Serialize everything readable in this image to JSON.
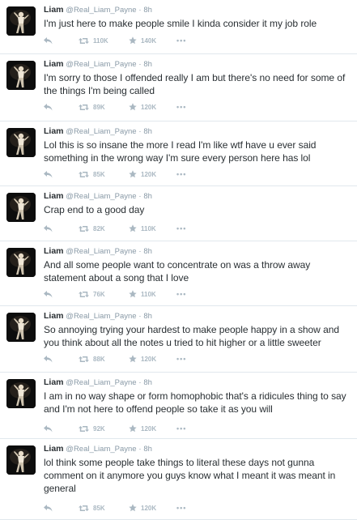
{
  "tweets": [
    {
      "name": "Liam",
      "handle": "@Real_Liam_Payne",
      "dot": "·",
      "time": "8h",
      "text": "I'm just here to make people smile  I kinda consider it my job role",
      "retweets": "110K",
      "favorites": "140K"
    },
    {
      "name": "Liam",
      "handle": "@Real_Liam_Payne",
      "dot": "·",
      "time": "8h",
      "text": "I'm sorry to those I offended really I am but there's no need for some of the things I'm being called",
      "retweets": "89K",
      "favorites": "120K"
    },
    {
      "name": "Liam",
      "handle": "@Real_Liam_Payne",
      "dot": "·",
      "time": "8h",
      "text": "Lol this is so insane the more I read I'm like wtf have u ever said something in the wrong way I'm sure every person here has lol",
      "retweets": "85K",
      "favorites": "120K"
    },
    {
      "name": "Liam",
      "handle": "@Real_Liam_Payne",
      "dot": "·",
      "time": "8h",
      "text": "Crap end to a good day",
      "retweets": "82K",
      "favorites": "110K"
    },
    {
      "name": "Liam",
      "handle": "@Real_Liam_Payne",
      "dot": "·",
      "time": "8h",
      "text": "And all some people want to concentrate on was a throw away statement about a song that I love",
      "retweets": "76K",
      "favorites": "110K"
    },
    {
      "name": "Liam",
      "handle": "@Real_Liam_Payne",
      "dot": "·",
      "time": "8h",
      "text": "So annoying trying your hardest to make people happy in a show and you think about all the notes u tried to hit higher or a little sweeter",
      "retweets": "88K",
      "favorites": "120K"
    },
    {
      "name": "Liam",
      "handle": "@Real_Liam_Payne",
      "dot": "·",
      "time": "8h",
      "text": "I am in no way shape or form homophobic that's a ridicules thing to say and I'm not here to offend people so take it as you will",
      "retweets": "92K",
      "favorites": "120K"
    },
    {
      "name": "Liam",
      "handle": "@Real_Liam_Payne",
      "dot": "·",
      "time": "8h",
      "text": "lol think some people take things to literal these days not gunna comment on it anymore you guys know what I meant it was meant in general",
      "retweets": "85K",
      "favorites": "120K"
    }
  ],
  "icons": {
    "reply": "reply-icon",
    "retweet": "retweet-icon",
    "favorite": "star-icon",
    "more": "more-dots-icon"
  },
  "colors": {
    "text": "#292f33",
    "meta": "#8899a6",
    "actions": "#aab8c2",
    "divider": "#e1e8ed"
  },
  "more_label": "•••"
}
